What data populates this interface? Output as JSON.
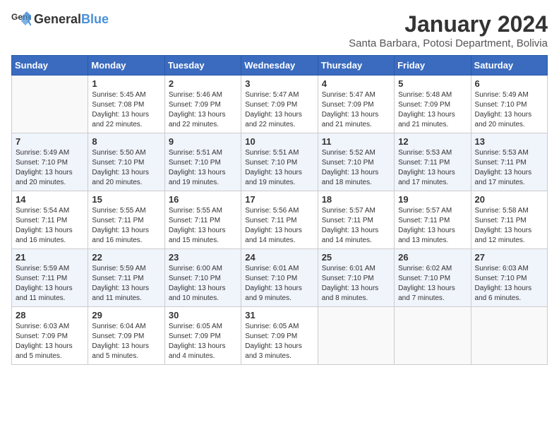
{
  "logo": {
    "text_general": "General",
    "text_blue": "Blue"
  },
  "header": {
    "month_year": "January 2024",
    "location": "Santa Barbara, Potosi Department, Bolivia"
  },
  "weekdays": [
    "Sunday",
    "Monday",
    "Tuesday",
    "Wednesday",
    "Thursday",
    "Friday",
    "Saturday"
  ],
  "weeks": [
    [
      {
        "day": "",
        "empty": true
      },
      {
        "day": "1",
        "sunrise": "5:45 AM",
        "sunset": "7:08 PM",
        "daylight": "13 hours and 22 minutes."
      },
      {
        "day": "2",
        "sunrise": "5:46 AM",
        "sunset": "7:09 PM",
        "daylight": "13 hours and 22 minutes."
      },
      {
        "day": "3",
        "sunrise": "5:47 AM",
        "sunset": "7:09 PM",
        "daylight": "13 hours and 22 minutes."
      },
      {
        "day": "4",
        "sunrise": "5:47 AM",
        "sunset": "7:09 PM",
        "daylight": "13 hours and 21 minutes."
      },
      {
        "day": "5",
        "sunrise": "5:48 AM",
        "sunset": "7:09 PM",
        "daylight": "13 hours and 21 minutes."
      },
      {
        "day": "6",
        "sunrise": "5:49 AM",
        "sunset": "7:10 PM",
        "daylight": "13 hours and 20 minutes."
      }
    ],
    [
      {
        "day": "7",
        "sunrise": "5:49 AM",
        "sunset": "7:10 PM",
        "daylight": "13 hours and 20 minutes."
      },
      {
        "day": "8",
        "sunrise": "5:50 AM",
        "sunset": "7:10 PM",
        "daylight": "13 hours and 20 minutes."
      },
      {
        "day": "9",
        "sunrise": "5:51 AM",
        "sunset": "7:10 PM",
        "daylight": "13 hours and 19 minutes."
      },
      {
        "day": "10",
        "sunrise": "5:51 AM",
        "sunset": "7:10 PM",
        "daylight": "13 hours and 19 minutes."
      },
      {
        "day": "11",
        "sunrise": "5:52 AM",
        "sunset": "7:10 PM",
        "daylight": "13 hours and 18 minutes."
      },
      {
        "day": "12",
        "sunrise": "5:53 AM",
        "sunset": "7:11 PM",
        "daylight": "13 hours and 17 minutes."
      },
      {
        "day": "13",
        "sunrise": "5:53 AM",
        "sunset": "7:11 PM",
        "daylight": "13 hours and 17 minutes."
      }
    ],
    [
      {
        "day": "14",
        "sunrise": "5:54 AM",
        "sunset": "7:11 PM",
        "daylight": "13 hours and 16 minutes."
      },
      {
        "day": "15",
        "sunrise": "5:55 AM",
        "sunset": "7:11 PM",
        "daylight": "13 hours and 16 minutes."
      },
      {
        "day": "16",
        "sunrise": "5:55 AM",
        "sunset": "7:11 PM",
        "daylight": "13 hours and 15 minutes."
      },
      {
        "day": "17",
        "sunrise": "5:56 AM",
        "sunset": "7:11 PM",
        "daylight": "13 hours and 14 minutes."
      },
      {
        "day": "18",
        "sunrise": "5:57 AM",
        "sunset": "7:11 PM",
        "daylight": "13 hours and 14 minutes."
      },
      {
        "day": "19",
        "sunrise": "5:57 AM",
        "sunset": "7:11 PM",
        "daylight": "13 hours and 13 minutes."
      },
      {
        "day": "20",
        "sunrise": "5:58 AM",
        "sunset": "7:11 PM",
        "daylight": "13 hours and 12 minutes."
      }
    ],
    [
      {
        "day": "21",
        "sunrise": "5:59 AM",
        "sunset": "7:11 PM",
        "daylight": "13 hours and 11 minutes."
      },
      {
        "day": "22",
        "sunrise": "5:59 AM",
        "sunset": "7:11 PM",
        "daylight": "13 hours and 11 minutes."
      },
      {
        "day": "23",
        "sunrise": "6:00 AM",
        "sunset": "7:10 PM",
        "daylight": "13 hours and 10 minutes."
      },
      {
        "day": "24",
        "sunrise": "6:01 AM",
        "sunset": "7:10 PM",
        "daylight": "13 hours and 9 minutes."
      },
      {
        "day": "25",
        "sunrise": "6:01 AM",
        "sunset": "7:10 PM",
        "daylight": "13 hours and 8 minutes."
      },
      {
        "day": "26",
        "sunrise": "6:02 AM",
        "sunset": "7:10 PM",
        "daylight": "13 hours and 7 minutes."
      },
      {
        "day": "27",
        "sunrise": "6:03 AM",
        "sunset": "7:10 PM",
        "daylight": "13 hours and 6 minutes."
      }
    ],
    [
      {
        "day": "28",
        "sunrise": "6:03 AM",
        "sunset": "7:09 PM",
        "daylight": "13 hours and 5 minutes."
      },
      {
        "day": "29",
        "sunrise": "6:04 AM",
        "sunset": "7:09 PM",
        "daylight": "13 hours and 5 minutes."
      },
      {
        "day": "30",
        "sunrise": "6:05 AM",
        "sunset": "7:09 PM",
        "daylight": "13 hours and 4 minutes."
      },
      {
        "day": "31",
        "sunrise": "6:05 AM",
        "sunset": "7:09 PM",
        "daylight": "13 hours and 3 minutes."
      },
      {
        "day": "",
        "empty": true
      },
      {
        "day": "",
        "empty": true
      },
      {
        "day": "",
        "empty": true
      }
    ]
  ],
  "labels": {
    "sunrise": "Sunrise:",
    "sunset": "Sunset:",
    "daylight": "Daylight:"
  }
}
